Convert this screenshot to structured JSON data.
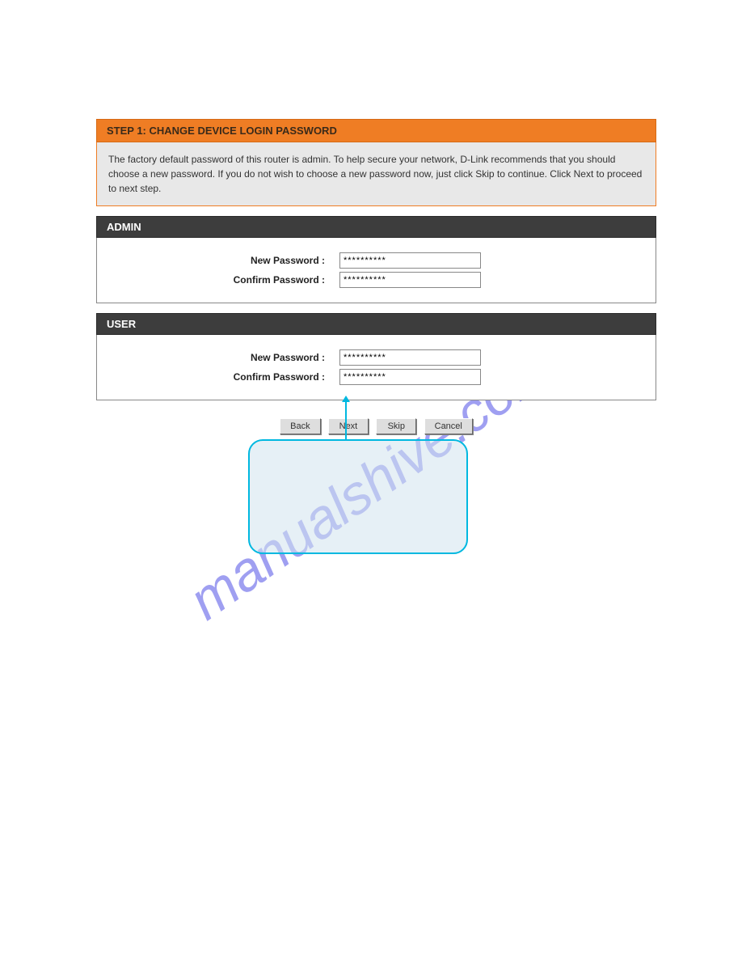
{
  "step_header": "STEP 1: CHANGE DEVICE LOGIN PASSWORD",
  "description": "The factory default password of this router is admin. To help secure your network, D-Link recommends that you should choose a new password. If you do not wish to choose a new password now, just click Skip to continue. Click Next to proceed to next step.",
  "admin": {
    "header": "ADMIN",
    "new_password_label": "New Password :",
    "new_password_value": "**********",
    "confirm_password_label": "Confirm Password :",
    "confirm_password_value": "**********"
  },
  "user": {
    "header": "USER",
    "new_password_label": "New Password :",
    "new_password_value": "**********",
    "confirm_password_label": "Confirm Password :",
    "confirm_password_value": "**********"
  },
  "buttons": {
    "back": "Back",
    "next": "Next",
    "skip": "Skip",
    "cancel": "Cancel"
  },
  "watermark": "manualshive.com"
}
